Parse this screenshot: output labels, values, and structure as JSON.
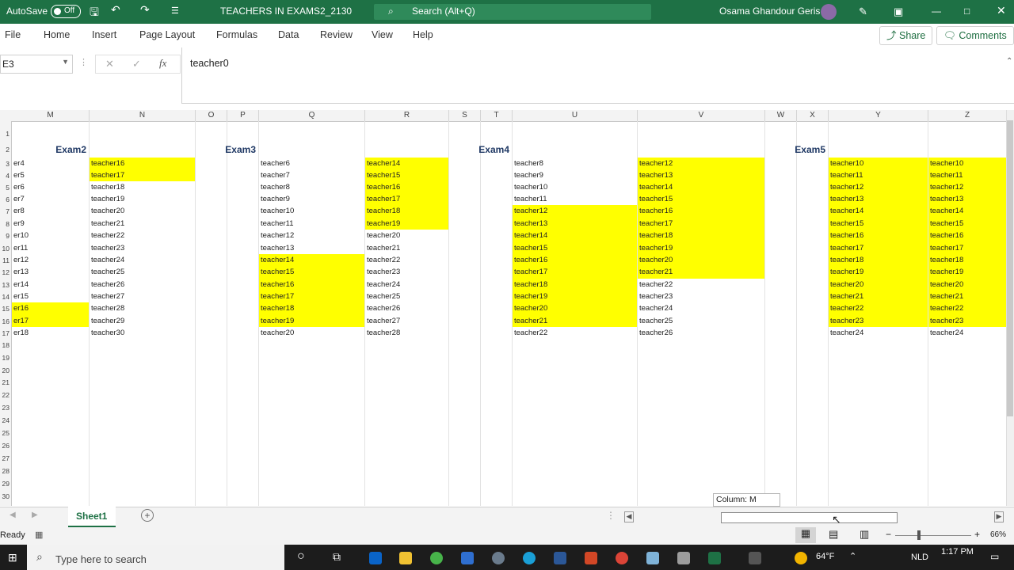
{
  "title_bar": {
    "autosave_label": "AutoSave",
    "autosave_state": "Off",
    "filename": "TEACHERS IN EXAMS2_2130",
    "search_placeholder": "Search (Alt+Q)",
    "user_name": "Osama Ghandour Geris"
  },
  "menu": {
    "tabs": [
      "File",
      "Home",
      "Insert",
      "Page Layout",
      "Formulas",
      "Data",
      "Review",
      "View",
      "Help"
    ],
    "share_label": "Share",
    "comments_label": "Comments"
  },
  "formula_bar": {
    "name_box": "E3",
    "formula": "teacher0"
  },
  "columns": [
    "M",
    "N",
    "O",
    "P",
    "Q",
    "R",
    "S",
    "T",
    "U",
    "V",
    "W",
    "X",
    "Y",
    "Z"
  ],
  "row_numbers": [
    "1",
    "2",
    "3",
    "4",
    "5",
    "6",
    "7",
    "8",
    "9",
    "10",
    "11",
    "12",
    "13",
    "14",
    "15",
    "16",
    "17",
    "18",
    "19",
    "20",
    "21",
    "22",
    "23",
    "24",
    "25",
    "26",
    "27",
    "28",
    "29",
    "30"
  ],
  "exam_headers": [
    "Exam2",
    "Exam3",
    "Exam4",
    "Exam5"
  ],
  "grid": {
    "M": [
      "er4",
      "er5",
      "er6",
      "er7",
      "er8",
      "er9",
      "er10",
      "er11",
      "er12",
      "er13",
      "er14",
      "er15",
      "er16",
      "er17",
      "er18"
    ],
    "N": [
      "teacher16",
      "teacher17",
      "teacher18",
      "teacher19",
      "teacher20",
      "teacher21",
      "teacher22",
      "teacher23",
      "teacher24",
      "teacher25",
      "teacher26",
      "teacher27",
      "teacher28",
      "teacher29",
      "teacher30"
    ],
    "Q": [
      "teacher6",
      "teacher7",
      "teacher8",
      "teacher9",
      "teacher10",
      "teacher11",
      "teacher12",
      "teacher13",
      "teacher14",
      "teacher15",
      "teacher16",
      "teacher17",
      "teacher18",
      "teacher19",
      "teacher20"
    ],
    "R": [
      "teacher14",
      "teacher15",
      "teacher16",
      "teacher17",
      "teacher18",
      "teacher19",
      "teacher20",
      "teacher21",
      "teacher22",
      "teacher23",
      "teacher24",
      "teacher25",
      "teacher26",
      "teacher27",
      "teacher28"
    ],
    "U": [
      "teacher8",
      "teacher9",
      "teacher10",
      "teacher11",
      "teacher12",
      "teacher13",
      "teacher14",
      "teacher15",
      "teacher16",
      "teacher17",
      "teacher18",
      "teacher19",
      "teacher20",
      "teacher21",
      "teacher22"
    ],
    "V": [
      "teacher12",
      "teacher13",
      "teacher14",
      "teacher15",
      "teacher16",
      "teacher17",
      "teacher18",
      "teacher19",
      "teacher20",
      "teacher21",
      "teacher22",
      "teacher23",
      "teacher24",
      "teacher25",
      "teacher26"
    ],
    "Y": [
      "teacher10",
      "teacher11",
      "teacher12",
      "teacher13",
      "teacher14",
      "teacher15",
      "teacher16",
      "teacher17",
      "teacher18",
      "teacher19",
      "teacher20",
      "teacher21",
      "teacher22",
      "teacher23",
      "teacher24"
    ],
    "Z": [
      "teacher10",
      "teacher11",
      "teacher12",
      "teacher13",
      "teacher14",
      "teacher15",
      "teacher16",
      "teacher17",
      "teacher18",
      "teacher19",
      "teacher20",
      "teacher21",
      "teacher22",
      "teacher23",
      "teacher24"
    ]
  },
  "highlight_color": "#ffff00",
  "sheet_tab": "Sheet1",
  "tooltip": "Column: M",
  "status": {
    "ready": "Ready",
    "zoom": "66%"
  },
  "taskbar": {
    "search_placeholder": "Type here to search",
    "weather": "64°F",
    "lang": "NLD",
    "time": "1:17 PM"
  }
}
